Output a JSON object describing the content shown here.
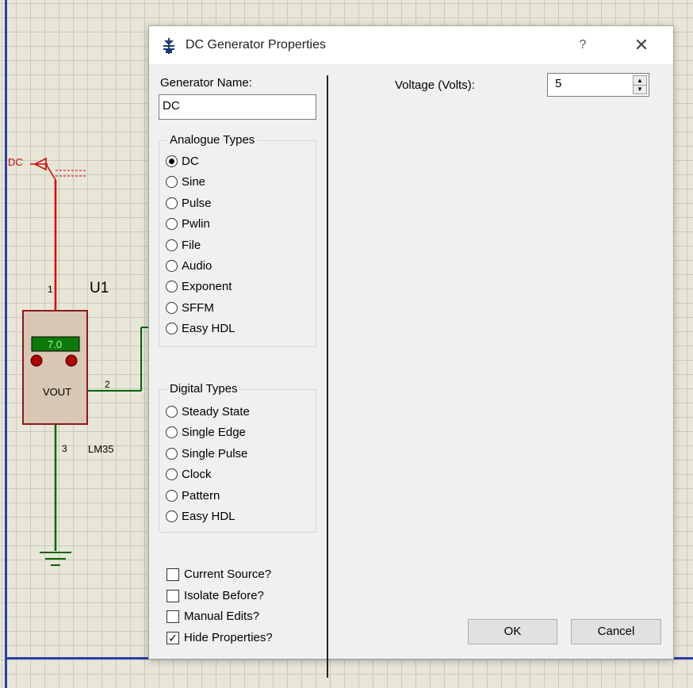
{
  "schematic": {
    "generator_label": "DC",
    "component_ref": "U1",
    "component_part": "LM35",
    "display_value": "7.0",
    "pin_vout": "VOUT",
    "pin1": "1",
    "pin2": "2",
    "pin3": "3",
    "colors": {
      "wire_red": "#d40000",
      "wire_green": "#006600",
      "component_fill": "#d8c7b4",
      "component_border": "#8b1a1a"
    }
  },
  "dialog": {
    "title": "DC Generator Properties",
    "title_icon": "generator-icon",
    "help_label": "?",
    "close_label": "✕",
    "generator_name_label": "Generator Name:",
    "generator_name_value": "DC",
    "analogue": {
      "title": "Analogue Types",
      "options": [
        "DC",
        "Sine",
        "Pulse",
        "Pwlin",
        "File",
        "Audio",
        "Exponent",
        "SFFM",
        "Easy HDL"
      ],
      "selected": "DC"
    },
    "digital": {
      "title": "Digital Types",
      "options": [
        "Steady State",
        "Single Edge",
        "Single Pulse",
        "Clock",
        "Pattern",
        "Easy HDL"
      ],
      "selected": ""
    },
    "checkboxes": [
      {
        "label": "Current Source?",
        "checked": false
      },
      {
        "label": "Isolate Before?",
        "checked": false
      },
      {
        "label": "Manual Edits?",
        "checked": false
      },
      {
        "label": "Hide Properties?",
        "checked": true
      }
    ],
    "voltage_label": "Voltage (Volts):",
    "voltage_value": "5",
    "ok_label": "OK",
    "cancel_label": "Cancel"
  }
}
